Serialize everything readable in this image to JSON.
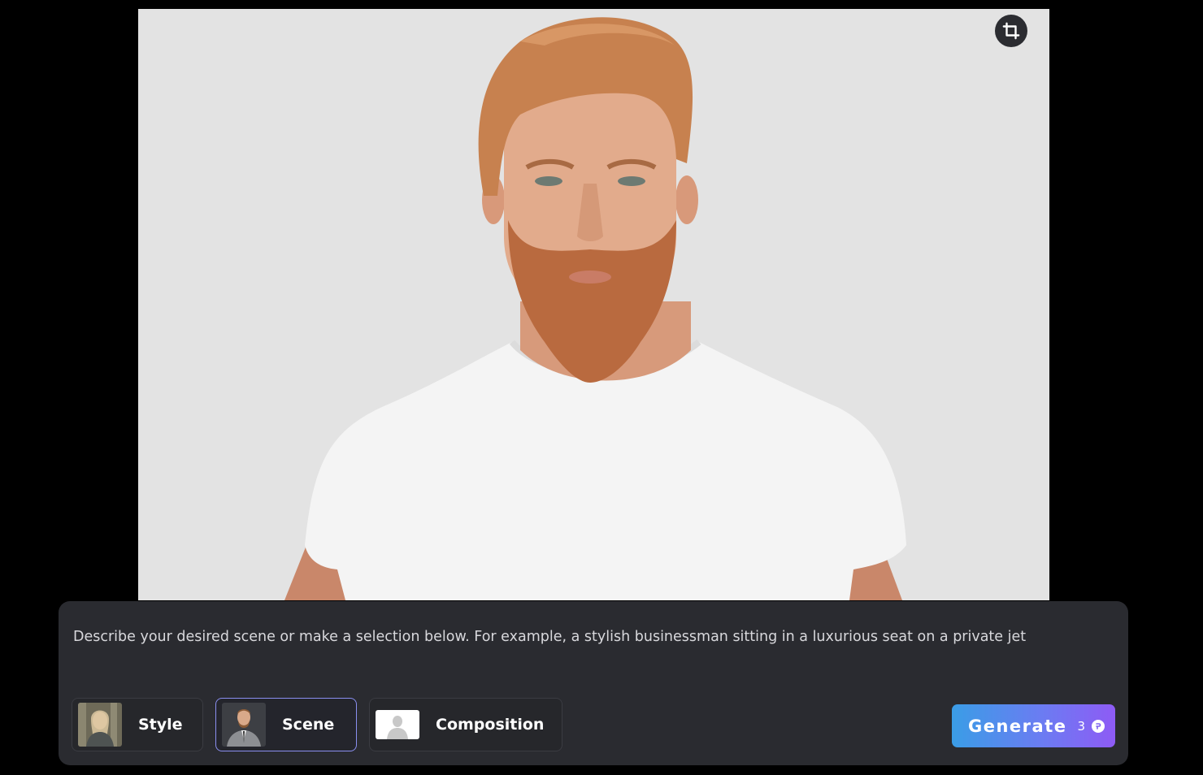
{
  "canvas": {
    "image_subject": "portrait-bearded-man-white-tshirt",
    "background_color": "#e3e3e3",
    "crop_icon": "crop-icon"
  },
  "prompt": {
    "placeholder": "Describe your desired scene or make a selection below. For example, a stylish businessman sitting in a luxurious seat on a private jet",
    "value": ""
  },
  "options": [
    {
      "label": "Style",
      "thumb": "woman-in-forest-thumbnail",
      "selected": false
    },
    {
      "label": "Scene",
      "thumb": "man-in-suit-thumbnail",
      "selected": true
    },
    {
      "label": "Composition",
      "thumb": "person-silhouette-thumbnail",
      "selected": false
    }
  ],
  "generate": {
    "label": "Generate",
    "cost": "3",
    "coin_icon": "credit-coin-icon",
    "gradient_start": "#3a9de6",
    "gradient_end": "#8e5bf5"
  },
  "colors": {
    "page_background": "#000000",
    "panel_background": "#2a2b30",
    "selected_border": "#8a8ff0"
  }
}
